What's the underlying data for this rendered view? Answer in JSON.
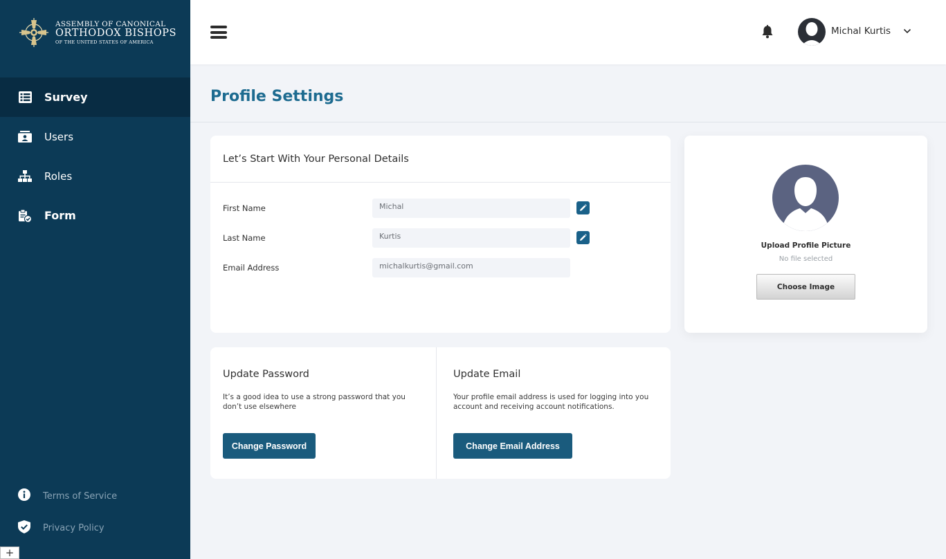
{
  "brand": {
    "line1": "ASSEMBLY OF CANONICAL",
    "line2": "ORTHODOX BISHOPS",
    "line3": "OF THE UNITED STATES OF AMERICA"
  },
  "sidebar": {
    "items": [
      {
        "label": "Survey",
        "icon": "list-icon",
        "active": true
      },
      {
        "label": "Users",
        "icon": "id-card-icon",
        "active": false
      },
      {
        "label": "Roles",
        "icon": "sitemap-icon",
        "active": false
      },
      {
        "label": "Form",
        "icon": "clipboard-check-icon",
        "active": false
      }
    ],
    "footer": [
      {
        "label": "Terms of Service",
        "icon": "info-circle-icon"
      },
      {
        "label": "Privacy Policy",
        "icon": "shield-check-icon"
      }
    ],
    "corner_glyph": "+"
  },
  "header": {
    "user_name": "Michal Kurtis"
  },
  "page": {
    "title_bold": "Profile",
    "title_rest": " Settings"
  },
  "personal": {
    "heading": "Let’s Start With Your Personal Details",
    "fields": [
      {
        "label": "First Name",
        "value": "Michal",
        "editable": true
      },
      {
        "label": "Last Name",
        "value": "Kurtis",
        "editable": true
      },
      {
        "label": "Email Address",
        "value": "michalkurtis@gmail.com",
        "editable": false
      }
    ]
  },
  "upload": {
    "label": "Upload Profile Picture",
    "status": "No file selected",
    "button": "Choose Image"
  },
  "password": {
    "heading": "Update Password",
    "description": "It’s a good idea to use a strong password that you don’t use elsewhere",
    "button": "Change Password"
  },
  "email": {
    "heading": "Update Email",
    "description": "Your profile email address is used for logging into you account and receiving account notifications.",
    "button": "Change Email Address"
  },
  "colors": {
    "sidebar": "#0c3a56",
    "sidebar_active": "#082c43",
    "accent": "#1d6b90",
    "button": "#1a5b7d",
    "background": "#f2f4f8"
  }
}
